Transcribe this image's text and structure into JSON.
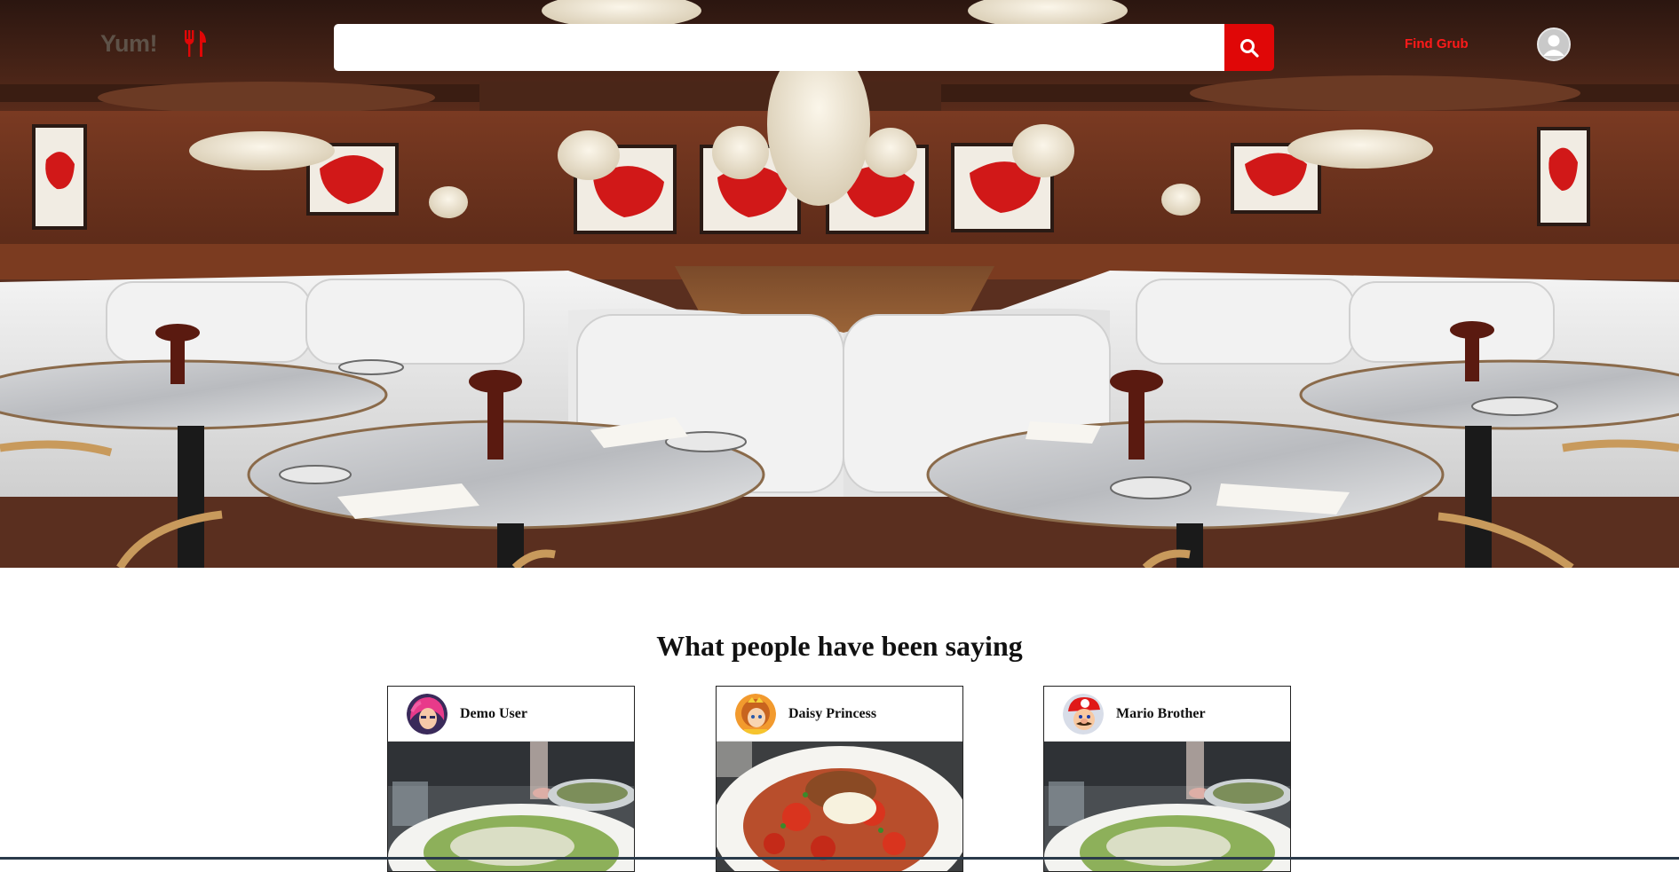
{
  "nav": {
    "logo_text": "Yum!",
    "logo_icon": "fork-knife-icon",
    "search": {
      "value": "",
      "placeholder": "",
      "button_icon": "search-icon"
    },
    "find_grub_label": "Find Grub",
    "profile_icon": "user-avatar-icon"
  },
  "reviews": {
    "title": "What people have been saying",
    "cards": [
      {
        "user": "Demo User",
        "avatar": "pink-hair-avatar",
        "photo": "caesar-salad-photo"
      },
      {
        "user": "Daisy Princess",
        "avatar": "princess-daisy-avatar",
        "photo": "pasta-dish-photo"
      },
      {
        "user": "Mario Brother",
        "avatar": "mario-avatar",
        "photo": "caesar-salad-photo"
      }
    ]
  },
  "colors": {
    "accent": "#e00707",
    "find_grub": "#ff1a1a",
    "logo": "#5e5248"
  }
}
